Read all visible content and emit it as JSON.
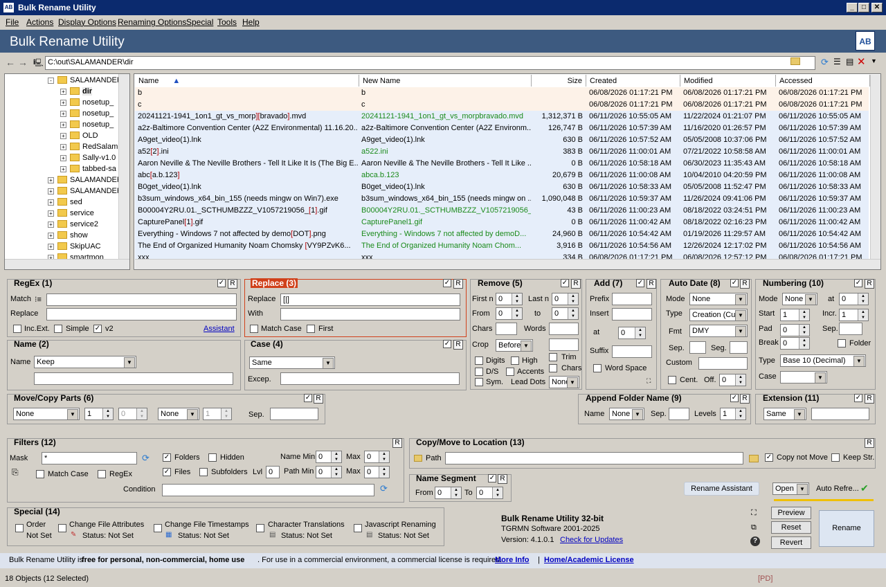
{
  "window": {
    "title": "Bulk Rename Utility",
    "min": "_",
    "max": "□",
    "close": "✕"
  },
  "menu": [
    "File",
    "Actions",
    "Display Options",
    "Renaming Options",
    "Special",
    "Tools",
    "Help"
  ],
  "banner": {
    "title": "Bulk Rename Utility",
    "logo": "AB"
  },
  "path": {
    "value": "C:\\out\\SALAMANDER\\dir"
  },
  "tree": [
    {
      "label": "SALAMANDER",
      "indent": 3,
      "exp": "-"
    },
    {
      "label": "dir",
      "indent": 4,
      "exp": "+",
      "bold": true
    },
    {
      "label": "nosetup_",
      "indent": 4,
      "exp": "+"
    },
    {
      "label": "nosetup_",
      "indent": 4,
      "exp": "+"
    },
    {
      "label": "nosetup_",
      "indent": 4,
      "exp": "+"
    },
    {
      "label": "OLD",
      "indent": 4,
      "exp": "+"
    },
    {
      "label": "RedSalam",
      "indent": 4,
      "exp": "+"
    },
    {
      "label": "Sally-v1.0",
      "indent": 4,
      "exp": "+"
    },
    {
      "label": "tabbed-sa",
      "indent": 4,
      "exp": "+"
    },
    {
      "label": "SALAMANDER",
      "indent": 3,
      "exp": "+"
    },
    {
      "label": "SALAMANDER",
      "indent": 3,
      "exp": "+"
    },
    {
      "label": "sed",
      "indent": 3,
      "exp": "+"
    },
    {
      "label": "service",
      "indent": 3,
      "exp": "+"
    },
    {
      "label": "service2",
      "indent": 3,
      "exp": "+"
    },
    {
      "label": "show",
      "indent": 3,
      "exp": "+"
    },
    {
      "label": "SkipUAC",
      "indent": 3,
      "exp": "+"
    },
    {
      "label": "smartmon",
      "indent": 3,
      "exp": "+"
    }
  ],
  "columns": {
    "name": "Name",
    "newname": "New Name",
    "size": "Size",
    "created": "Created",
    "modified": "Modified",
    "accessed": "Accessed"
  },
  "files": [
    {
      "parts": [
        {
          "t": "b"
        }
      ],
      "newname": "b",
      "nn_changed": false,
      "size": "",
      "created": "06/08/2026 01:17:21 PM",
      "modified": "06/08/2026 01:17:21 PM",
      "accessed": "06/08/2026 01:17:21 PM",
      "folder": true
    },
    {
      "parts": [
        {
          "t": "c"
        }
      ],
      "newname": "c",
      "nn_changed": false,
      "size": "",
      "created": "06/08/2026 01:17:21 PM",
      "modified": "06/08/2026 01:17:21 PM",
      "accessed": "06/08/2026 01:17:21 PM",
      "folder": true
    },
    {
      "parts": [
        {
          "t": "20241121-1941_1on1_gt_vs_morp"
        },
        {
          "t": "][",
          "r": true
        },
        {
          "t": "bravado"
        },
        {
          "t": "]",
          "r": true
        },
        {
          "t": ".mvd"
        }
      ],
      "newname": "20241121-1941_1on1_gt_vs_morpbravado.mvd",
      "nn_changed": true,
      "size": "1,312,371 B",
      "created": "06/11/2026 10:55:05 AM",
      "modified": "11/22/2024 01:21:07 PM",
      "accessed": "06/11/2026 10:55:05 AM"
    },
    {
      "parts": [
        {
          "t": "a2z-Baltimore Convention Center (A2Z Environmental) 11.16.20..."
        }
      ],
      "newname": "a2z-Baltimore Convention Center (A2Z Environm...",
      "nn_changed": false,
      "size": "126,747 B",
      "created": "06/11/2026 10:57:39 AM",
      "modified": "11/16/2020 01:26:57 PM",
      "accessed": "06/11/2026 10:57:39 AM"
    },
    {
      "parts": [
        {
          "t": "A9get_video(1).lnk"
        }
      ],
      "newname": "A9get_video(1).lnk",
      "nn_changed": false,
      "size": "630 B",
      "created": "06/11/2026 10:57:52 AM",
      "modified": "05/05/2008 10:37:06 PM",
      "accessed": "06/11/2026 10:57:52 AM"
    },
    {
      "parts": [
        {
          "t": "a52"
        },
        {
          "t": "[",
          "r": true
        },
        {
          "t": "2"
        },
        {
          "t": "]",
          "r": true
        },
        {
          "t": ".ini"
        }
      ],
      "newname": "a522.ini",
      "nn_changed": true,
      "size": "383 B",
      "created": "06/11/2026 11:00:01 AM",
      "modified": "07/21/2022 10:58:58 AM",
      "accessed": "06/11/2026 11:00:01 AM"
    },
    {
      "parts": [
        {
          "t": "Aaron Neville & The Neville Brothers - Tell It Like It Is (The Big E..."
        }
      ],
      "newname": "Aaron Neville & The Neville Brothers - Tell It Like ...",
      "nn_changed": false,
      "size": "0 B",
      "created": "06/11/2026 10:58:18 AM",
      "modified": "06/30/2023 11:35:43 AM",
      "accessed": "06/11/2026 10:58:18 AM"
    },
    {
      "parts": [
        {
          "t": "abc"
        },
        {
          "t": "[",
          "r": true
        },
        {
          "t": "a.b.123"
        },
        {
          "t": "]",
          "r": true
        }
      ],
      "newname": "abca.b.123",
      "nn_changed": true,
      "size": "20,679 B",
      "created": "06/11/2026 11:00:08 AM",
      "modified": "10/04/2010 04:20:59 PM",
      "accessed": "06/11/2026 11:00:08 AM"
    },
    {
      "parts": [
        {
          "t": "B0get_video(1).lnk"
        }
      ],
      "newname": "B0get_video(1).lnk",
      "nn_changed": false,
      "size": "630 B",
      "created": "06/11/2026 10:58:33 AM",
      "modified": "05/05/2008 11:52:47 PM",
      "accessed": "06/11/2026 10:58:33 AM"
    },
    {
      "parts": [
        {
          "t": "b3sum_windows_x64_bin_155 (needs mingw on Win7).exe"
        }
      ],
      "newname": "b3sum_windows_x64_bin_155 (needs mingw on ...",
      "nn_changed": false,
      "size": "1,090,048 B",
      "created": "06/11/2026 10:59:37 AM",
      "modified": "11/26/2024 09:41:06 PM",
      "accessed": "06/11/2026 10:59:37 AM"
    },
    {
      "parts": [
        {
          "t": "B00004Y2RU.01._SCTHUMBZZZ_V1057219056_"
        },
        {
          "t": "[",
          "r": true
        },
        {
          "t": "1"
        },
        {
          "t": "]",
          "r": true
        },
        {
          "t": ".gif"
        }
      ],
      "newname": "B00004Y2RU.01._SCTHUMBZZZ_V1057219056_1...",
      "nn_changed": true,
      "size": "43 B",
      "created": "06/11/2026 11:00:23 AM",
      "modified": "08/18/2022 03:24:51 PM",
      "accessed": "06/11/2026 11:00:23 AM"
    },
    {
      "parts": [
        {
          "t": "CapturePanel"
        },
        {
          "t": "[",
          "r": true
        },
        {
          "t": "1"
        },
        {
          "t": "]",
          "r": true
        },
        {
          "t": ".gif"
        }
      ],
      "newname": "CapturePanel1.gif",
      "nn_changed": true,
      "size": "0 B",
      "created": "06/11/2026 11:00:42 AM",
      "modified": "08/18/2022 02:16:23 PM",
      "accessed": "06/11/2026 11:00:42 AM"
    },
    {
      "parts": [
        {
          "t": "Everything - Windows 7 not affected by demo"
        },
        {
          "t": "[",
          "r": true
        },
        {
          "t": "DOT"
        },
        {
          "t": "]",
          "r": true
        },
        {
          "t": ".png"
        }
      ],
      "newname": "Everything - Windows 7 not affected by demoD...",
      "nn_changed": true,
      "size": "24,960 B",
      "created": "06/11/2026 10:54:42 AM",
      "modified": "01/19/2026 11:29:57 AM",
      "accessed": "06/11/2026 10:54:42 AM"
    },
    {
      "parts": [
        {
          "t": "The End of Organized Humanity     Noam Chomsky "
        },
        {
          "t": "[",
          "r": true
        },
        {
          "t": "VY9PZvK6..."
        }
      ],
      "newname": "The End of Organized Humanity     Noam Chom...",
      "nn_changed": true,
      "size": "3,916 B",
      "created": "06/11/2026 10:54:56 AM",
      "modified": "12/26/2024 12:17:02 PM",
      "accessed": "06/11/2026 10:54:56 AM"
    },
    {
      "parts": [
        {
          "t": "xxx"
        }
      ],
      "newname": "xxx",
      "nn_changed": false,
      "size": "334 B",
      "created": "06/08/2026 01:17:21 PM",
      "modified": "06/08/2026 12:57:12 PM",
      "accessed": "06/08/2026 01:17:21 PM"
    }
  ],
  "regex": {
    "title": "RegEx (1)",
    "match": "Match",
    "replace": "Replace",
    "incext": "Inc.Ext.",
    "simple": "Simple",
    "v2": "v2",
    "assistant": "Assistant",
    "r": "R"
  },
  "replace": {
    "title": "Replace (3)",
    "replace": "Replace",
    "replace_value": "[|]",
    "with": "With",
    "matchcase": "Match Case",
    "first": "First"
  },
  "remove": {
    "title": "Remove (5)",
    "firstn": "First n",
    "firstn_val": "0",
    "lastn": "Last n",
    "lastn_val": "0",
    "from": "From",
    "from_val": "0",
    "to": "to",
    "to_val": "0",
    "chars": "Chars",
    "words": "Words",
    "crop": "Crop",
    "crop_val": "Before",
    "digits": "Digits",
    "high": "High",
    "trim": "Trim",
    "ds": "D/S",
    "accents": "Accents",
    "chars2": "Chars",
    "sym": "Sym.",
    "leaddots": "Lead Dots",
    "leaddots_val": "None"
  },
  "add": {
    "title": "Add (7)",
    "prefix": "Prefix",
    "insert": "Insert",
    "at": "at",
    "at_val": "0",
    "suffix": "Suffix",
    "wordspace": "Word Space"
  },
  "autodate": {
    "title": "Auto Date (8)",
    "mode": "Mode",
    "mode_val": "None",
    "type": "Type",
    "type_val": "Creation (Cur",
    "fmt": "Fmt",
    "fmt_val": "DMY",
    "sep": "Sep.",
    "seg": "Seg.",
    "custom": "Custom",
    "cent": "Cent.",
    "off": "Off.",
    "off_val": "0"
  },
  "numbering": {
    "title": "Numbering (10)",
    "mode": "Mode",
    "mode_val": "None",
    "at": "at",
    "at_val": "0",
    "start": "Start",
    "start_val": "1",
    "incr": "Incr.",
    "incr_val": "1",
    "pad": "Pad",
    "pad_val": "0",
    "sep": "Sep.",
    "break": "Break",
    "break_val": "0",
    "folder": "Folder",
    "type": "Type",
    "type_val": "Base 10 (Decimal)",
    "case": "Case"
  },
  "name": {
    "title": "Name (2)",
    "label": "Name",
    "value": "Keep"
  },
  "case": {
    "title": "Case (4)",
    "value": "Same",
    "excep": "Excep."
  },
  "movecopy": {
    "title": "Move/Copy Parts (6)",
    "v1": "None",
    "v2": "1",
    "v3": "0",
    "v4": "None",
    "v5": "1",
    "sep": "Sep."
  },
  "appendfolder": {
    "title": "Append Folder Name (9)",
    "name": "Name",
    "name_val": "None",
    "sep": "Sep.",
    "levels": "Levels",
    "levels_val": "1"
  },
  "extension": {
    "title": "Extension (11)",
    "value": "Same"
  },
  "filters": {
    "title": "Filters (12)",
    "mask": "Mask",
    "mask_val": "*",
    "folders": "Folders",
    "hidden": "Hidden",
    "files": "Files",
    "subfolders": "Subfolders",
    "lvl": "Lvl",
    "lvl_val": "0",
    "namemin": "Name Min",
    "namemin_val": "0",
    "max": "Max",
    "max_val": "0",
    "pathmin": "Path Min",
    "pathmin_val": "0",
    "max2_val": "0",
    "matchcase": "Match Case",
    "regex": "RegEx",
    "condition": "Condition"
  },
  "copymove": {
    "title": "Copy/Move to Location (13)",
    "path": "Path",
    "copynotmove": "Copy not Move",
    "keepstr": "Keep Str."
  },
  "namesegment": {
    "title": "Name Segment",
    "from": "From",
    "from_val": "0",
    "to": "To",
    "to_val": "0"
  },
  "renameassistant": "Rename Assistant",
  "open": "Open",
  "autorefresh": "Auto Refre...",
  "special": {
    "title": "Special (14)",
    "order": "Order",
    "notset": "Not Set",
    "cfa": "Change File Attributes",
    "cft": "Change File Timestamps",
    "ct": "Character Translations",
    "js": "Javascript Renaming",
    "status": "Status: Not Set"
  },
  "about": {
    "title": "Bulk Rename Utility 32-bit",
    "company": "TGRMN Software 2001-2025",
    "version": "Version: 4.1.0.1",
    "updates": "Check for Updates"
  },
  "buttons": {
    "preview": "Preview",
    "reset": "Reset",
    "revert": "Revert",
    "rename": "Rename"
  },
  "info": {
    "p1": "Bulk Rename Utility is ",
    "p2": "free for personal, non-commercial, home use",
    "p3": ". For use in a commercial environment, a commercial license is required.",
    "moreinfo": "More Info",
    "sep": "|",
    "license": "Home/Academic License"
  },
  "status": {
    "objects": "18 Objects (12 Selected)",
    "pd": "[PD]"
  },
  "colors": {
    "banner": "#3d5a80",
    "title": "#0b2a6e",
    "changed": "#1a8a1a",
    "bracket": "#b00000",
    "replace_border": "#d0401a"
  }
}
